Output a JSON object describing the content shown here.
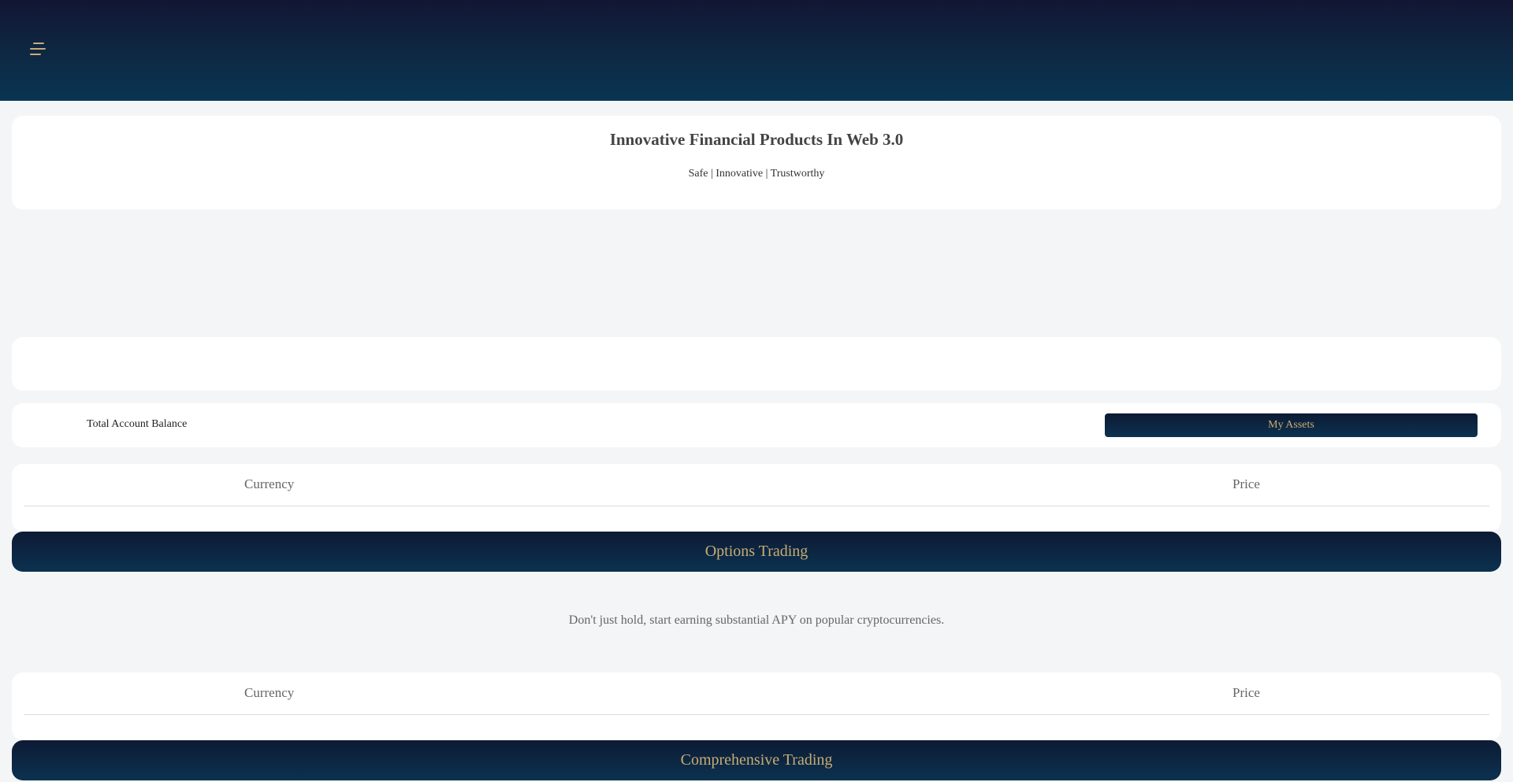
{
  "header": {
    "menu_icon": "menu-icon"
  },
  "hero": {
    "title": "Innovative Financial Products In Web 3.0",
    "subtitle": "Safe | Innovative | Trustworthy"
  },
  "account": {
    "total_label": "Total Account Balance",
    "my_assets_label": "My Assets"
  },
  "market_table": {
    "columns": [
      "Currency",
      "Price"
    ]
  },
  "options_section": {
    "title": "Options Trading",
    "tagline": "Don't just hold, start earning substantial APY on popular cryptocurrencies."
  },
  "options_table": {
    "columns": [
      "Currency",
      "Price"
    ]
  },
  "comprehensive_section": {
    "title": "Comprehensive Trading"
  },
  "colors": {
    "header_dark": "#121633",
    "header_light": "#093552",
    "accent_gold": "#c7ad72",
    "page_bg": "#f4f5f6"
  }
}
